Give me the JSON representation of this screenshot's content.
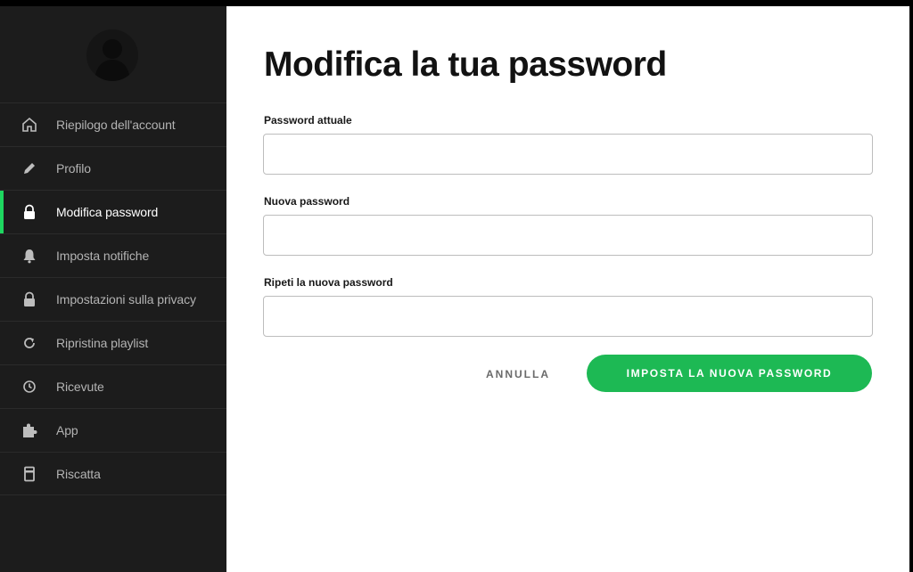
{
  "sidebar": {
    "items": [
      {
        "label": "Riepilogo dell'account",
        "icon": "home-icon",
        "active": false
      },
      {
        "label": "Profilo",
        "icon": "pencil-icon",
        "active": false
      },
      {
        "label": "Modifica password",
        "icon": "lock-icon",
        "active": true
      },
      {
        "label": "Imposta notifiche",
        "icon": "bell-icon",
        "active": false
      },
      {
        "label": "Impostazioni sulla privacy",
        "icon": "lock-icon",
        "active": false
      },
      {
        "label": "Ripristina playlist",
        "icon": "refresh-icon",
        "active": false
      },
      {
        "label": "Ricevute",
        "icon": "clock-icon",
        "active": false
      },
      {
        "label": "App",
        "icon": "puzzle-icon",
        "active": false
      },
      {
        "label": "Riscatta",
        "icon": "card-icon",
        "active": false
      }
    ]
  },
  "main": {
    "title": "Modifica la tua password",
    "fields": {
      "current": {
        "label": "Password attuale",
        "value": ""
      },
      "new": {
        "label": "Nuova password",
        "value": ""
      },
      "repeat": {
        "label": "Ripeti la nuova password",
        "value": ""
      }
    },
    "cancel_label": "ANNULLA",
    "submit_label": "IMPOSTA LA NUOVA PASSWORD"
  },
  "colors": {
    "accent": "#1db954",
    "sidebar_bg": "#1c1c1c",
    "main_bg": "#ffffff"
  }
}
